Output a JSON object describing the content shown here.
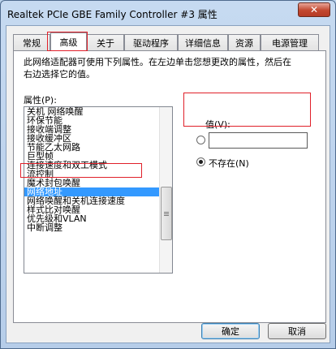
{
  "window": {
    "title": "Realtek PCIe GBE Family Controller #3 属性",
    "close_label": "✕"
  },
  "tabs": [
    {
      "label": "常规"
    },
    {
      "label": "高级"
    },
    {
      "label": "关于"
    },
    {
      "label": "驱动程序"
    },
    {
      "label": "详细信息"
    },
    {
      "label": "资源"
    },
    {
      "label": "电源管理"
    }
  ],
  "panel": {
    "description": "此网络适配器可使用下列属性。在左边单击您想更改的属性，然后在右边选择它的值。",
    "properties_label": "属性(P):",
    "properties": [
      "关机 网络唤醒",
      "环保节能",
      "接收端调整",
      "接收缓冲区",
      "节能乙太网路",
      "巨型帧",
      "连接速度和双工模式",
      "流控制",
      "魔术封包唤醒",
      "网络地址",
      "网络唤醒和关机连接速度",
      "样式比对唤醒",
      "优先级和VLAN",
      "中断调整"
    ],
    "selected_index": 9,
    "value_label": "值(V):",
    "value_input": "",
    "not_present_label": "不存在(N)"
  },
  "buttons": {
    "ok": "确定",
    "cancel": "取消"
  }
}
